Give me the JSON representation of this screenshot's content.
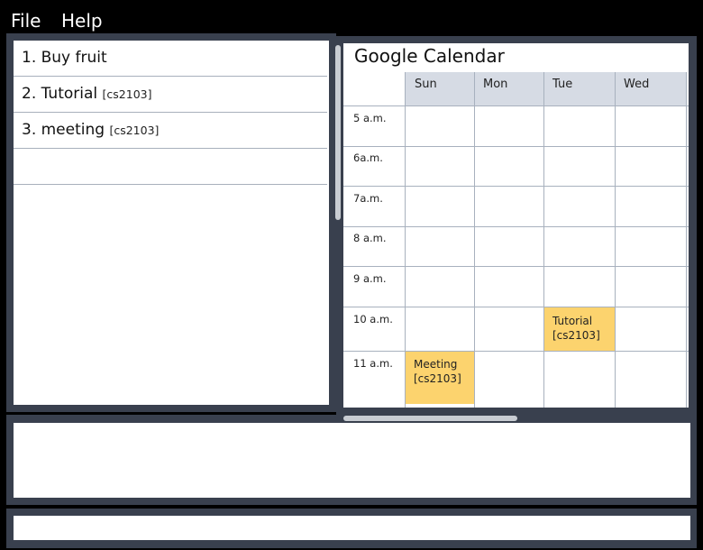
{
  "menu": {
    "file": "File",
    "help": "Help"
  },
  "tasks": [
    {
      "label": "1. Buy fruit",
      "tag": ""
    },
    {
      "label": "2. Tutorial",
      "tag": "[cs2103]"
    },
    {
      "label": "3. meeting",
      "tag": "[cs2103]"
    }
  ],
  "calendar": {
    "title": "Google Calendar",
    "days": [
      "Sun",
      "Mon",
      "Tue",
      "Wed"
    ],
    "times": [
      "5 a.m.",
      "6a.m.",
      "7a.m.",
      "8 a.m.",
      "9 a.m.",
      "10 a.m.",
      "11 a.m."
    ],
    "events": [
      {
        "title": "Tutorial",
        "tag": "[cs2103]",
        "day": "Tue",
        "time": "10 a.m."
      },
      {
        "title": "Meeting",
        "tag": "[cs2103]",
        "day": "Sun",
        "time": "11 a.m."
      }
    ]
  },
  "colors": {
    "background": "#39404e",
    "event": "#fcd36e",
    "header": "#d6dbe4"
  }
}
